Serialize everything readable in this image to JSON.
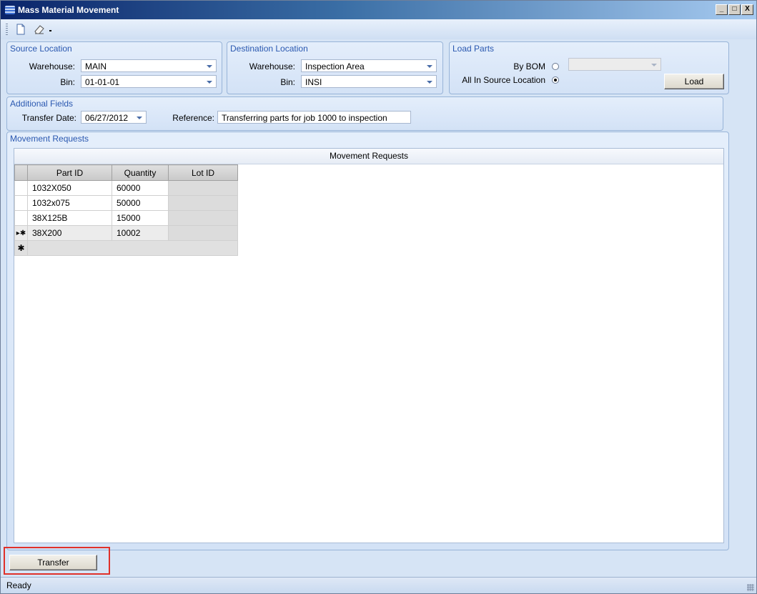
{
  "window": {
    "title": "Mass Material Movement",
    "controls": [
      "_",
      "□",
      "X"
    ]
  },
  "toolbar": {
    "icons": [
      "new-document-icon",
      "eraser-icon",
      "dropdown-arrow-icon"
    ]
  },
  "source_location": {
    "title": "Source Location",
    "warehouse_label": "Warehouse:",
    "warehouse_value": "MAIN",
    "bin_label": "Bin:",
    "bin_value": "01-01-01"
  },
  "destination_location": {
    "title": "Destination Location",
    "warehouse_label": "Warehouse:",
    "warehouse_value": "Inspection Area",
    "bin_label": "Bin:",
    "bin_value": "INSI"
  },
  "load_parts": {
    "title": "Load Parts",
    "by_bom_label": "By BOM",
    "by_bom_selected": false,
    "by_bom_value": "",
    "all_in_source_label": "All In Source Location",
    "all_in_source_selected": true,
    "load_button": "Load"
  },
  "additional_fields": {
    "title": "Additional Fields",
    "transfer_date_label": "Transfer Date:",
    "transfer_date_value": "06/27/2012",
    "reference_label": "Reference:",
    "reference_value": "Transferring parts for job 1000 to inspection"
  },
  "movement_requests": {
    "group_title": "Movement Requests",
    "grid_caption": "Movement Requests",
    "columns": [
      "Part ID",
      "Quantity",
      "Lot ID"
    ],
    "rows": [
      {
        "marker": "",
        "part_id": "1032X050",
        "quantity": "60000",
        "lot_id": ""
      },
      {
        "marker": "",
        "part_id": "1032x075",
        "quantity": "50000",
        "lot_id": ""
      },
      {
        "marker": "",
        "part_id": "38X125B",
        "quantity": "15000",
        "lot_id": ""
      },
      {
        "marker": "▸✱",
        "part_id": "38X200",
        "quantity": "10002",
        "lot_id": ""
      }
    ],
    "new_row_marker": "✱"
  },
  "actions": {
    "transfer_button": "Transfer"
  },
  "status": {
    "text": "Ready"
  }
}
